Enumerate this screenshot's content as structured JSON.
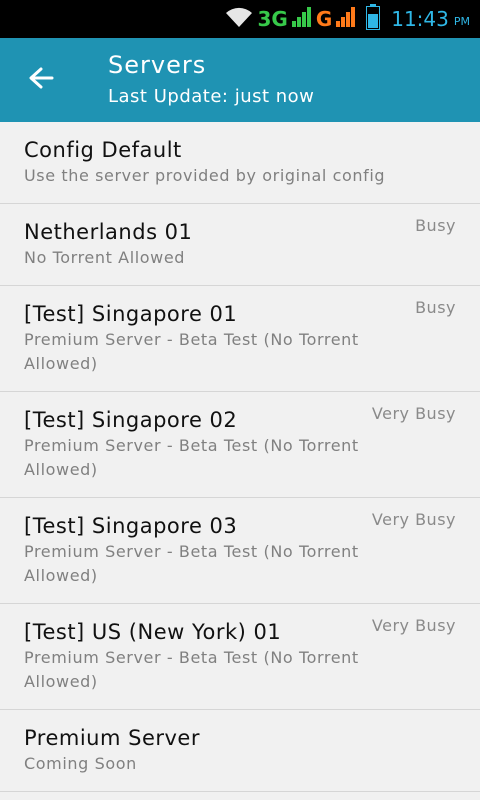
{
  "status_bar": {
    "network_3g": "3G",
    "network_g": "G",
    "time": "11:43",
    "time_suffix": "PM",
    "icons": [
      "wifi-icon",
      "signal-icon",
      "battery-icon"
    ],
    "colors": {
      "3g": "#37c94a",
      "g": "#ff7a1a",
      "time": "#2fb7e6"
    }
  },
  "app_bar": {
    "title": "Servers",
    "subtitle": "Last Update: just now",
    "back_icon": "arrow-left-icon",
    "color": "#1f93b3"
  },
  "servers": [
    {
      "name": "Config Default",
      "description": "Use the server provided by original config",
      "status": ""
    },
    {
      "name": "Netherlands 01",
      "description": "No Torrent Allowed",
      "status": "Busy"
    },
    {
      "name": "[Test] Singapore 01",
      "description": "Premium Server - Beta Test (No Torrent Allowed)",
      "status": "Busy"
    },
    {
      "name": "[Test] Singapore 02",
      "description": "Premium Server - Beta Test (No Torrent Allowed)",
      "status": "Very Busy"
    },
    {
      "name": "[Test] Singapore 03",
      "description": "Premium Server - Beta Test (No Torrent Allowed)",
      "status": "Very Busy"
    },
    {
      "name": "[Test] US (New York) 01",
      "description": "Premium Server - Beta Test (No Torrent Allowed)",
      "status": "Very Busy"
    },
    {
      "name": "Premium Server",
      "description": "Coming Soon",
      "status": ""
    }
  ]
}
